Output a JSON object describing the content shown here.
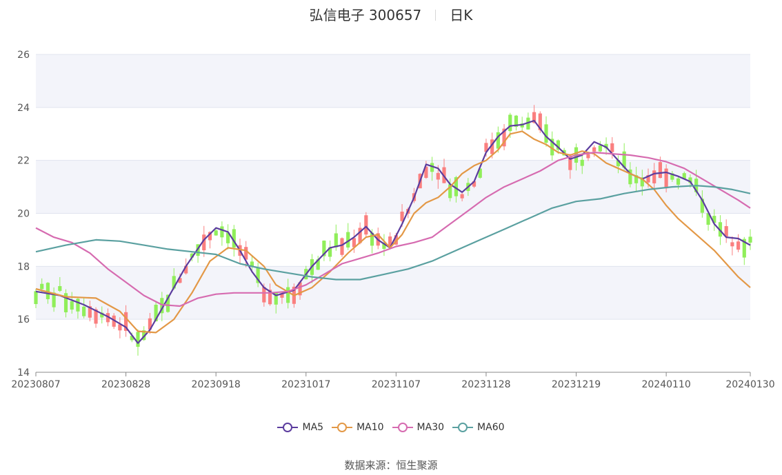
{
  "header": {
    "stock_name": "弘信电子 300657",
    "period_label": "日K"
  },
  "colors": {
    "up": "#fa7f7f",
    "down": "#90ee5a",
    "band": "#f3f4fa",
    "grid": "#e0e3ef"
  },
  "source": {
    "label": "数据来源：",
    "value": "恒生聚源"
  },
  "chart_data": {
    "type": "candlestick",
    "title": "弘信电子 300657 日K",
    "x_ticks": [
      "20230807",
      "20230828",
      "20230918",
      "20231017",
      "20231107",
      "20231128",
      "20231219",
      "20240110",
      "20240130"
    ],
    "x_tick_index": [
      0,
      15,
      30,
      45,
      60,
      75,
      90,
      105,
      119
    ],
    "n_days": 120,
    "ylim": [
      14,
      26
    ],
    "y_ticks": [
      14,
      16,
      18,
      20,
      22,
      24,
      26
    ],
    "series": [
      {
        "name": "MA5",
        "color": "#5b3c9e",
        "points": [
          [
            0,
            17.05
          ],
          [
            4,
            16.9
          ],
          [
            8,
            16.55
          ],
          [
            12,
            16.1
          ],
          [
            15,
            15.7
          ],
          [
            17,
            15.1
          ],
          [
            19,
            15.6
          ],
          [
            22,
            16.8
          ],
          [
            25,
            18.0
          ],
          [
            28,
            19.0
          ],
          [
            30,
            19.45
          ],
          [
            32,
            19.3
          ],
          [
            34,
            18.6
          ],
          [
            36,
            17.8
          ],
          [
            38,
            17.2
          ],
          [
            40,
            16.9
          ],
          [
            43,
            17.1
          ],
          [
            46,
            18.0
          ],
          [
            49,
            18.7
          ],
          [
            51,
            18.8
          ],
          [
            53,
            19.1
          ],
          [
            55,
            19.5
          ],
          [
            57,
            19.0
          ],
          [
            59,
            18.7
          ],
          [
            61,
            19.6
          ],
          [
            63,
            20.6
          ],
          [
            65,
            21.85
          ],
          [
            67,
            21.7
          ],
          [
            69,
            21.1
          ],
          [
            71,
            20.8
          ],
          [
            73,
            21.2
          ],
          [
            75,
            22.3
          ],
          [
            77,
            22.9
          ],
          [
            79,
            23.3
          ],
          [
            81,
            23.35
          ],
          [
            83,
            23.5
          ],
          [
            85,
            22.9
          ],
          [
            87,
            22.5
          ],
          [
            89,
            22.05
          ],
          [
            91,
            22.2
          ],
          [
            93,
            22.7
          ],
          [
            95,
            22.5
          ],
          [
            97,
            22.0
          ],
          [
            99,
            21.5
          ],
          [
            101,
            21.3
          ],
          [
            103,
            21.5
          ],
          [
            105,
            21.55
          ],
          [
            107,
            21.4
          ],
          [
            109,
            21.2
          ],
          [
            111,
            20.5
          ],
          [
            113,
            19.6
          ],
          [
            115,
            19.1
          ],
          [
            117,
            19.05
          ],
          [
            119,
            18.8
          ]
        ]
      },
      {
        "name": "MA10",
        "color": "#e39846",
        "points": [
          [
            0,
            17.15
          ],
          [
            5,
            16.85
          ],
          [
            10,
            16.8
          ],
          [
            14,
            16.3
          ],
          [
            17,
            15.55
          ],
          [
            20,
            15.5
          ],
          [
            23,
            16.0
          ],
          [
            26,
            17.0
          ],
          [
            29,
            18.2
          ],
          [
            32,
            18.7
          ],
          [
            35,
            18.6
          ],
          [
            38,
            18.0
          ],
          [
            40,
            17.3
          ],
          [
            43,
            16.9
          ],
          [
            46,
            17.2
          ],
          [
            49,
            17.8
          ],
          [
            52,
            18.5
          ],
          [
            55,
            19.1
          ],
          [
            57,
            19.2
          ],
          [
            59,
            18.7
          ],
          [
            61,
            19.2
          ],
          [
            63,
            20.0
          ],
          [
            65,
            20.4
          ],
          [
            67,
            20.6
          ],
          [
            69,
            21.0
          ],
          [
            71,
            21.5
          ],
          [
            73,
            21.8
          ],
          [
            75,
            22.0
          ],
          [
            77,
            22.4
          ],
          [
            79,
            23.0
          ],
          [
            81,
            23.1
          ],
          [
            83,
            22.8
          ],
          [
            85,
            22.6
          ],
          [
            87,
            22.3
          ],
          [
            89,
            22.2
          ],
          [
            91,
            22.35
          ],
          [
            93,
            22.25
          ],
          [
            95,
            21.9
          ],
          [
            97,
            21.7
          ],
          [
            99,
            21.5
          ],
          [
            101,
            21.3
          ],
          [
            103,
            20.9
          ],
          [
            105,
            20.3
          ],
          [
            107,
            19.8
          ],
          [
            109,
            19.4
          ],
          [
            111,
            19.0
          ],
          [
            113,
            18.6
          ],
          [
            115,
            18.1
          ],
          [
            117,
            17.6
          ],
          [
            119,
            17.2
          ]
        ]
      },
      {
        "name": "MA30",
        "color": "#d66bb0",
        "points": [
          [
            0,
            19.45
          ],
          [
            3,
            19.1
          ],
          [
            6,
            18.9
          ],
          [
            9,
            18.5
          ],
          [
            12,
            17.9
          ],
          [
            15,
            17.4
          ],
          [
            18,
            16.9
          ],
          [
            21,
            16.55
          ],
          [
            24,
            16.5
          ],
          [
            27,
            16.8
          ],
          [
            30,
            16.95
          ],
          [
            33,
            17.0
          ],
          [
            36,
            17.0
          ],
          [
            39,
            17.0
          ],
          [
            42,
            17.05
          ],
          [
            45,
            17.3
          ],
          [
            48,
            17.7
          ],
          [
            51,
            18.1
          ],
          [
            54,
            18.3
          ],
          [
            57,
            18.5
          ],
          [
            60,
            18.75
          ],
          [
            63,
            18.9
          ],
          [
            66,
            19.1
          ],
          [
            69,
            19.6
          ],
          [
            72,
            20.1
          ],
          [
            75,
            20.6
          ],
          [
            78,
            21.0
          ],
          [
            81,
            21.3
          ],
          [
            84,
            21.6
          ],
          [
            87,
            22.0
          ],
          [
            90,
            22.2
          ],
          [
            93,
            22.3
          ],
          [
            96,
            22.25
          ],
          [
            99,
            22.2
          ],
          [
            102,
            22.1
          ],
          [
            105,
            21.95
          ],
          [
            108,
            21.7
          ],
          [
            111,
            21.3
          ],
          [
            114,
            20.9
          ],
          [
            117,
            20.5
          ],
          [
            119,
            20.2
          ]
        ]
      },
      {
        "name": "MA60",
        "color": "#5aa0a0",
        "points": [
          [
            0,
            18.55
          ],
          [
            5,
            18.8
          ],
          [
            10,
            19.0
          ],
          [
            14,
            18.95
          ],
          [
            18,
            18.8
          ],
          [
            22,
            18.65
          ],
          [
            26,
            18.55
          ],
          [
            30,
            18.45
          ],
          [
            34,
            18.1
          ],
          [
            38,
            17.9
          ],
          [
            42,
            17.75
          ],
          [
            46,
            17.6
          ],
          [
            50,
            17.5
          ],
          [
            54,
            17.5
          ],
          [
            58,
            17.7
          ],
          [
            62,
            17.9
          ],
          [
            66,
            18.2
          ],
          [
            70,
            18.6
          ],
          [
            74,
            19.0
          ],
          [
            78,
            19.4
          ],
          [
            82,
            19.8
          ],
          [
            86,
            20.2
          ],
          [
            90,
            20.45
          ],
          [
            94,
            20.55
          ],
          [
            98,
            20.75
          ],
          [
            102,
            20.9
          ],
          [
            106,
            21.0
          ],
          [
            110,
            21.05
          ],
          [
            113,
            21.0
          ],
          [
            116,
            20.9
          ],
          [
            119,
            20.75
          ]
        ]
      }
    ]
  },
  "legend": [
    {
      "name": "MA5",
      "color": "#5b3c9e"
    },
    {
      "name": "MA10",
      "color": "#e39846"
    },
    {
      "name": "MA30",
      "color": "#d66bb0"
    },
    {
      "name": "MA60",
      "color": "#5aa0a0"
    }
  ]
}
